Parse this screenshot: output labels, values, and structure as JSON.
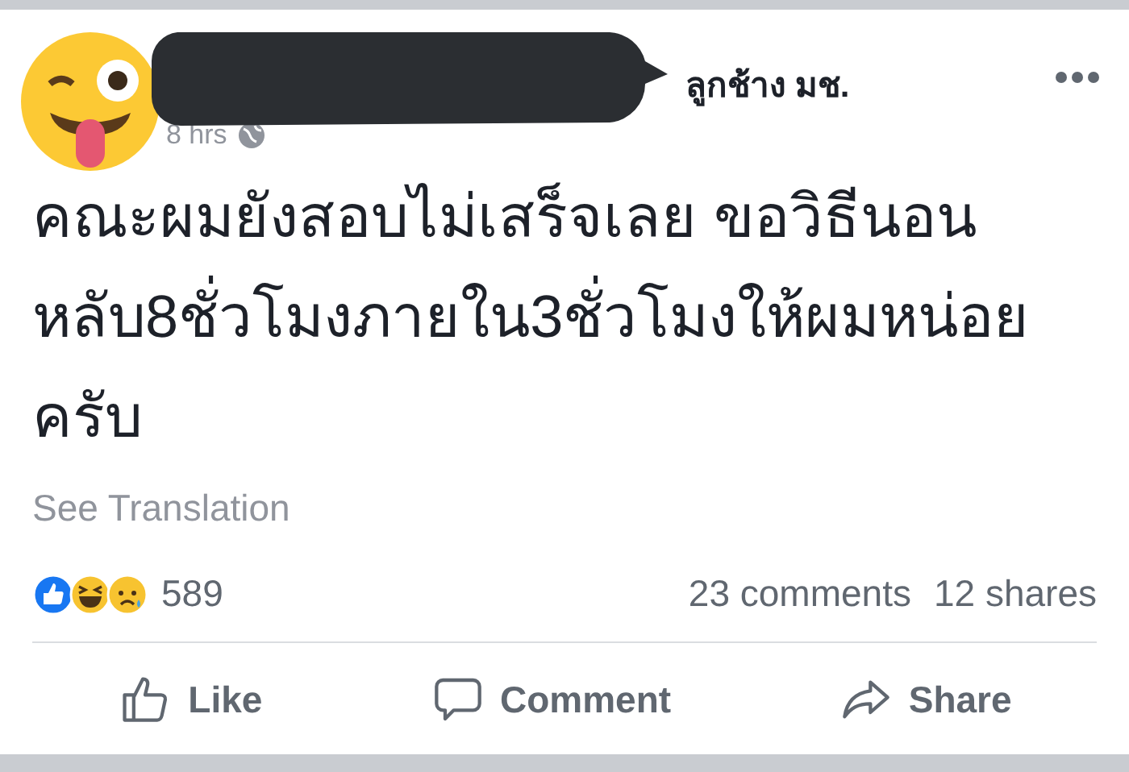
{
  "post": {
    "group": "ลูกช้าง มช.",
    "time": "8 hrs",
    "text": "คณะผมยังสอบไม่เสร็จเลย ขอวิธีนอนหลับ8ชั่วโมงภายใน3ชั่วโมงให้ผมหน่อยครับ",
    "translate_link": "See Translation"
  },
  "stats": {
    "reaction_count": "589",
    "comments": "23 comments",
    "shares": "12 shares"
  },
  "actions": [
    {
      "kind": "like",
      "label": "Like"
    },
    {
      "kind": "comment",
      "label": "Comment"
    },
    {
      "kind": "share",
      "label": "Share"
    }
  ]
}
